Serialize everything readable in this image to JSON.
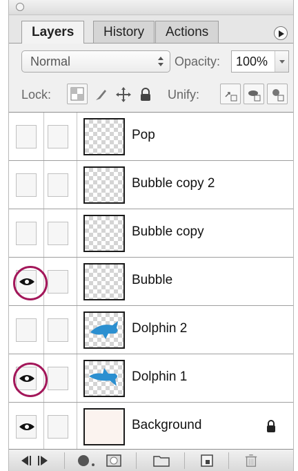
{
  "tabs": [
    {
      "label": "Layers",
      "active": true
    },
    {
      "label": "History",
      "active": false
    },
    {
      "label": "Actions",
      "active": false
    }
  ],
  "blend_mode": "Normal",
  "opacity": {
    "label": "Opacity:",
    "value": "100%"
  },
  "lock": {
    "label": "Lock:"
  },
  "unify": {
    "label": "Unify:"
  },
  "layers": [
    {
      "name": "Pop",
      "visible": false,
      "thumbnail": "transparent",
      "highlighted": false
    },
    {
      "name": "Bubble copy 2",
      "visible": false,
      "thumbnail": "transparent",
      "highlighted": false
    },
    {
      "name": "Bubble copy",
      "visible": false,
      "thumbnail": "transparent",
      "highlighted": false
    },
    {
      "name": "Bubble",
      "visible": true,
      "thumbnail": "transparent",
      "highlighted": true
    },
    {
      "name": "Dolphin 2",
      "visible": false,
      "thumbnail": "dolphin",
      "highlighted": false
    },
    {
      "name": "Dolphin 1",
      "visible": true,
      "thumbnail": "dolphin",
      "highlighted": true
    },
    {
      "name": "Background",
      "visible": true,
      "thumbnail": "background",
      "locked": true,
      "highlighted": false
    }
  ],
  "colors": {
    "highlight_circle": "#a3175a",
    "dolphin": "#2b8fd0"
  },
  "icons": [
    "eye-icon",
    "lock-icon",
    "brush-icon",
    "move-icon",
    "flyout-menu-icon",
    "link-layers-icon",
    "fx-icon",
    "mask-icon",
    "folder-icon",
    "new-layer-icon",
    "trash-icon"
  ]
}
